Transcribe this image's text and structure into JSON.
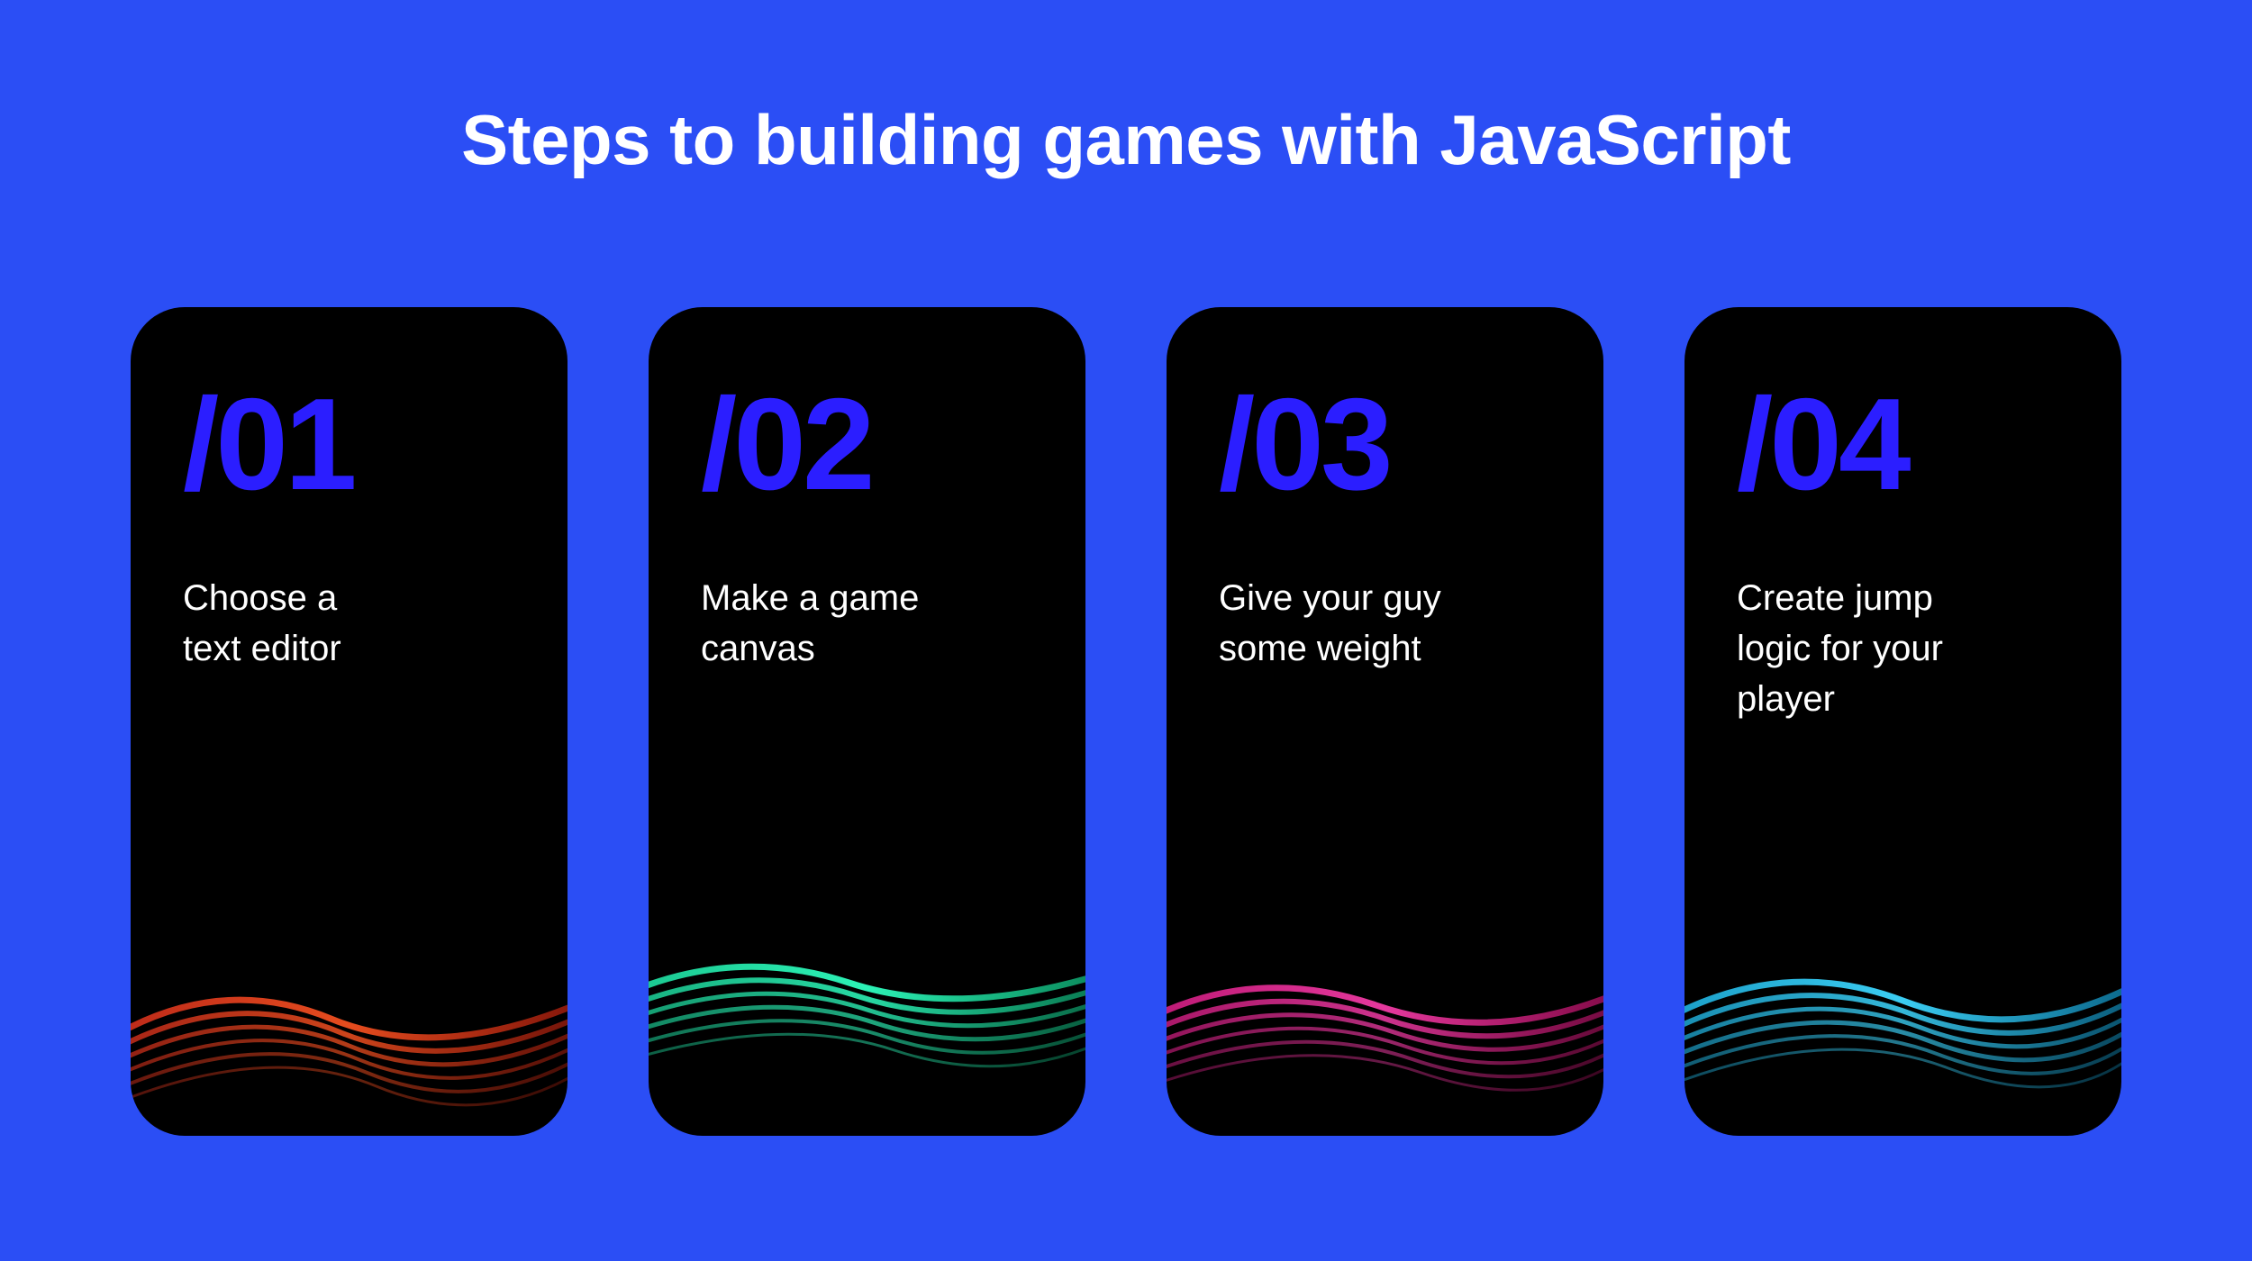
{
  "title": "Steps to building games with JavaScript",
  "cards": [
    {
      "number": "/01",
      "text": "Choose a\ntext editor",
      "waveColor": "#E8331F"
    },
    {
      "number": "/02",
      "text": "Make a game\ncanvas",
      "waveColor": "#1FE8A8"
    },
    {
      "number": "/03",
      "text": "Give your guy\nsome weight",
      "waveColor": "#E81F8F"
    },
    {
      "number": "/04",
      "text": "Create jump\nlogic for your\nplayer",
      "waveColor": "#1FB8E8"
    }
  ]
}
